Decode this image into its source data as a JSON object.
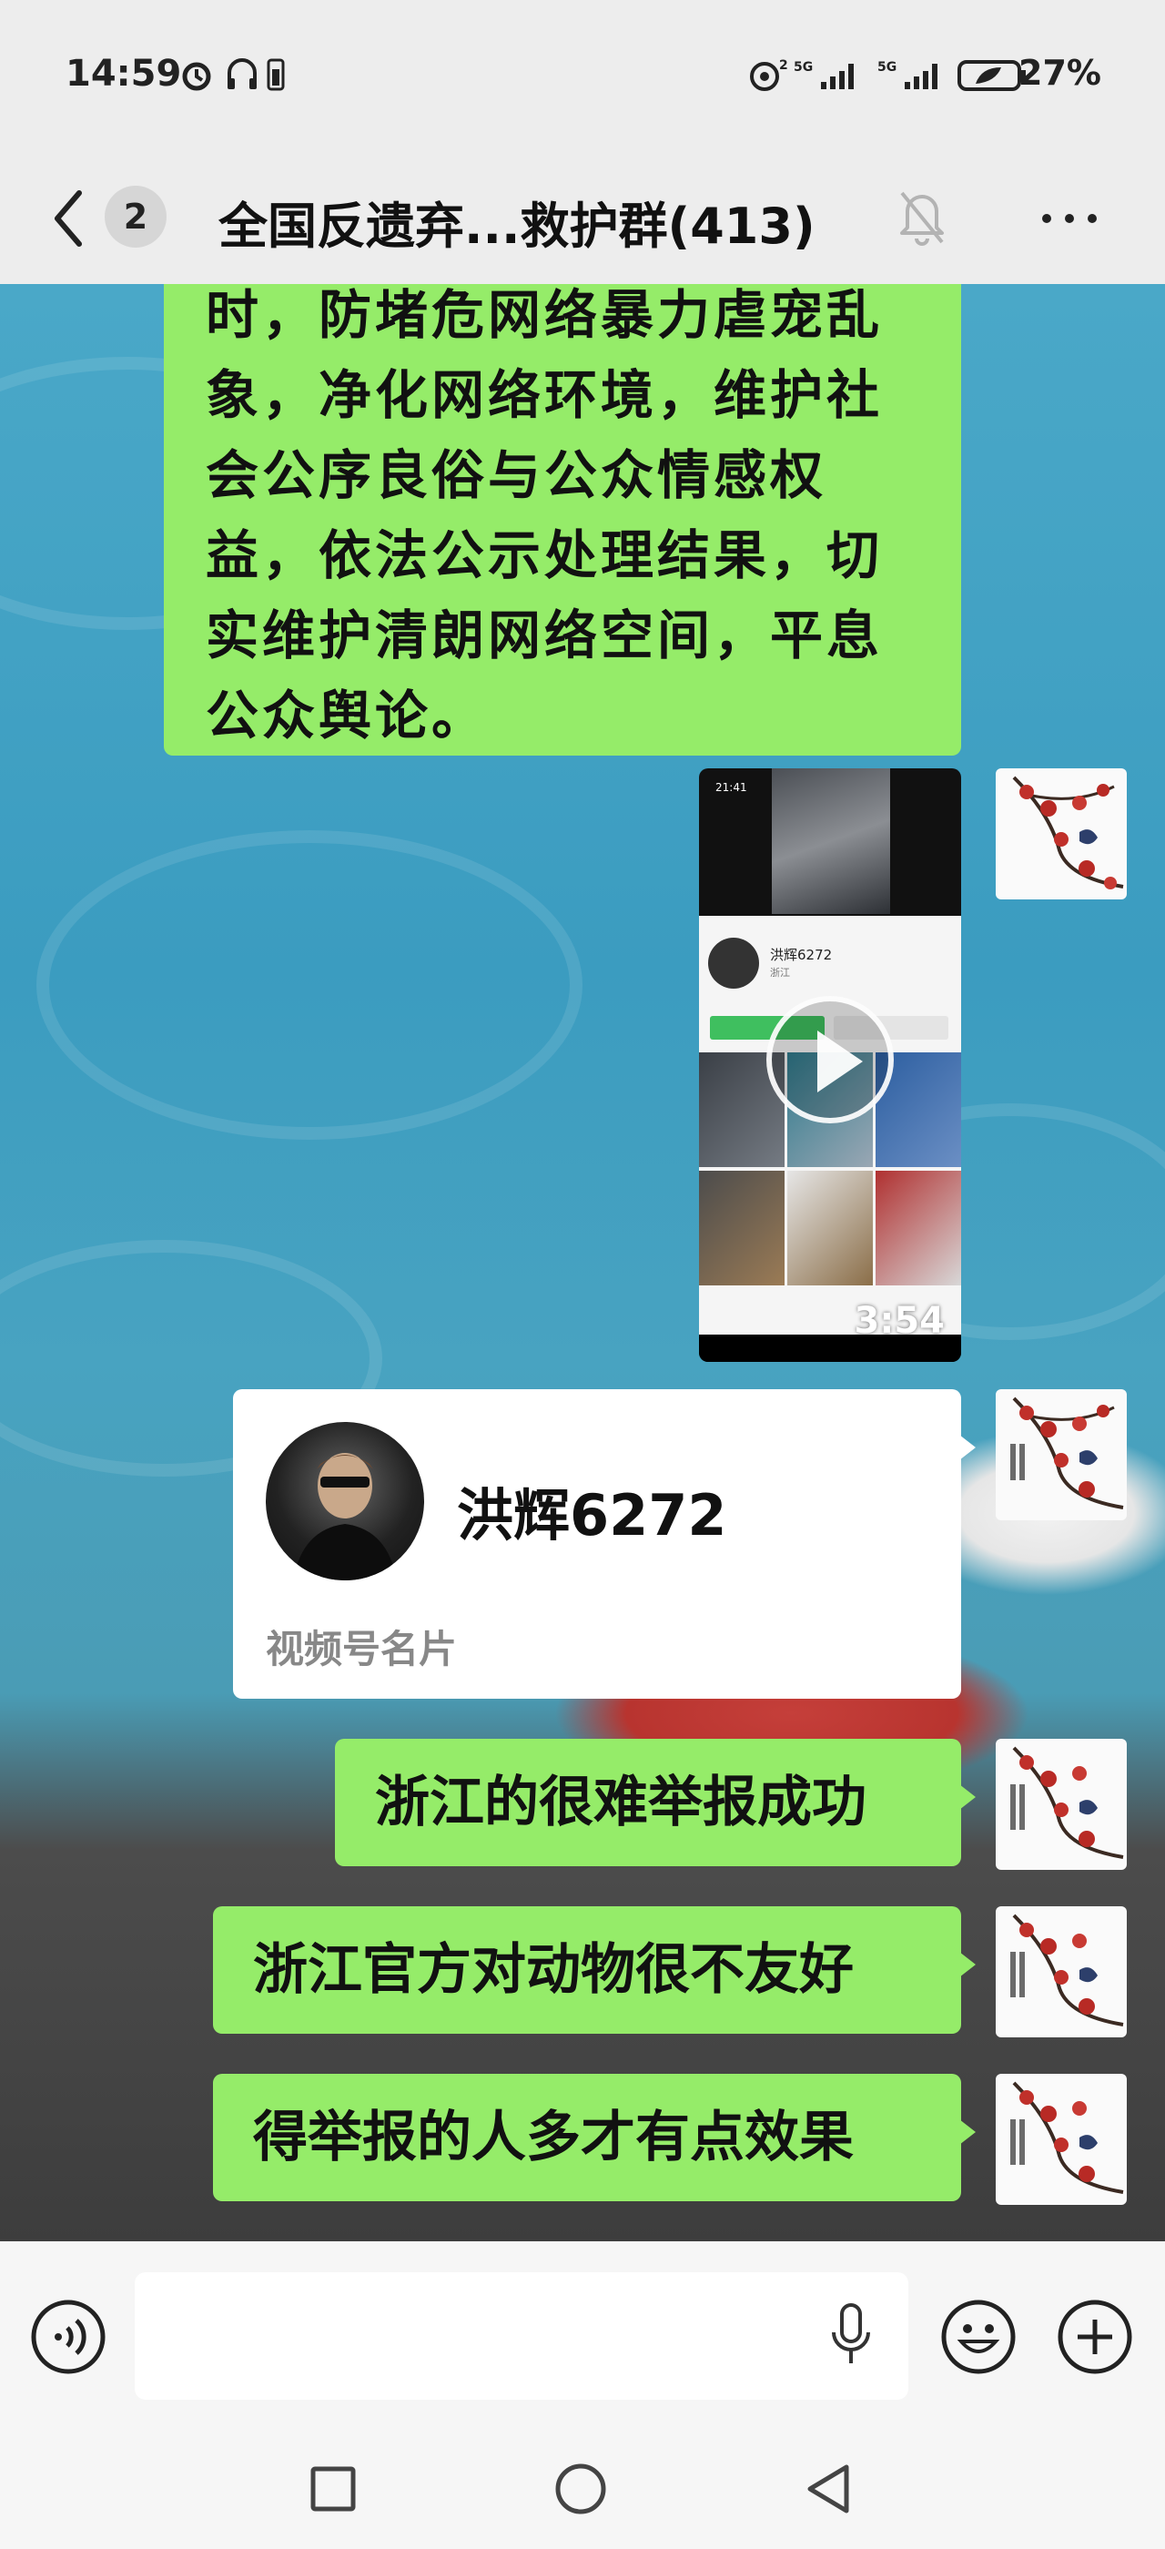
{
  "status_bar": {
    "time": "14:59",
    "battery_percent": "27%",
    "icons": [
      "alarm-icon",
      "headphones-icon",
      "hotspot-icon",
      "signal-5g-icon",
      "signal-5g-icon",
      "battery-icon"
    ]
  },
  "nav": {
    "unread_badge": "2",
    "title": "全国反遗弃...救护群(413)",
    "icons": [
      "back-icon",
      "mute-bell-icon",
      "more-icon"
    ]
  },
  "messages": {
    "long_text": {
      "lines": [
        "时，防堵危网络暴力虐宠乱",
        "象，净化网络环境，维护社",
        "会公序良俗与公众情感权",
        "益，依法公示处理结果，切",
        "实维护清朗网络空间，平息",
        "公众舆论。"
      ]
    },
    "video": {
      "duration": "3:54",
      "inner_time": "21:41",
      "inner_profile_name": "洪辉6272",
      "inner_profile_sub": "浙江"
    },
    "profile_card": {
      "name": "洪辉6272",
      "label": "视频号名片"
    },
    "m1": "浙江的很难举报成功",
    "m2": "浙江官方对动物很不友好",
    "m3": "得举报的人多才有点效果"
  },
  "input_bar": {
    "placeholder": "",
    "icons": [
      "voice-icon",
      "microphone-icon",
      "emoji-icon",
      "plus-icon"
    ]
  },
  "system_nav": {
    "icons": [
      "recents-square-icon",
      "home-circle-icon",
      "back-triangle-icon"
    ]
  },
  "colors": {
    "bubble_green": "#95ec69",
    "bar_gray": "#ededed",
    "chat_blue": "#4aa8c8"
  }
}
